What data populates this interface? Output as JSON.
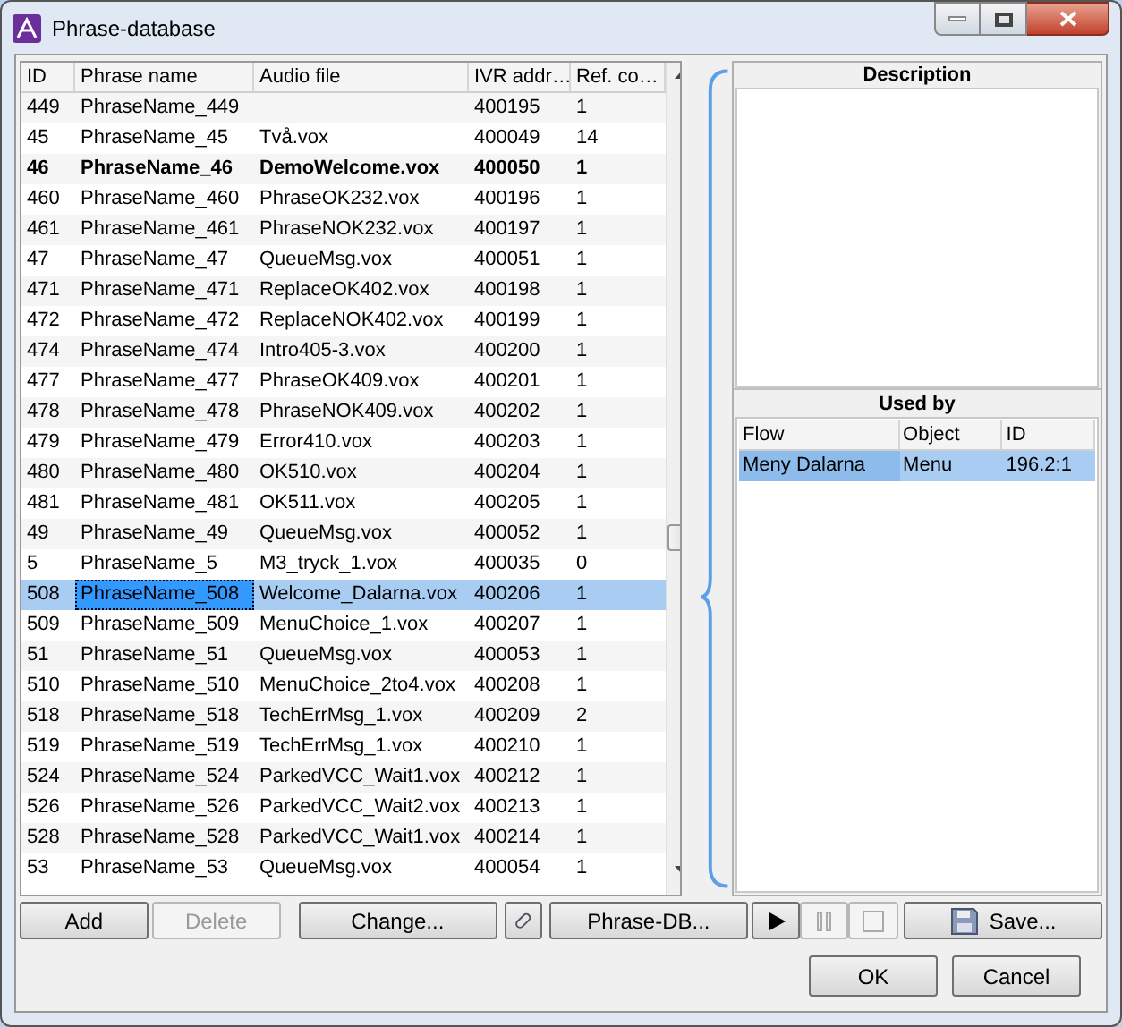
{
  "window": {
    "title": "Phrase-database"
  },
  "table": {
    "columns": [
      "ID",
      "Phrase name",
      "Audio file",
      "IVR addr…",
      "Ref. co…"
    ],
    "rows": [
      {
        "id": "449",
        "name": "PhraseName_449",
        "audio": "",
        "ivr": "400195",
        "ref": "1",
        "bold": false,
        "selected": false
      },
      {
        "id": "45",
        "name": "PhraseName_45",
        "audio": "Två.vox",
        "ivr": "400049",
        "ref": "14",
        "bold": false,
        "selected": false
      },
      {
        "id": "46",
        "name": "PhraseName_46",
        "audio": "DemoWelcome.vox",
        "ivr": "400050",
        "ref": "1",
        "bold": true,
        "selected": false
      },
      {
        "id": "460",
        "name": "PhraseName_460",
        "audio": "PhraseOK232.vox",
        "ivr": "400196",
        "ref": "1",
        "bold": false,
        "selected": false
      },
      {
        "id": "461",
        "name": "PhraseName_461",
        "audio": "PhraseNOK232.vox",
        "ivr": "400197",
        "ref": "1",
        "bold": false,
        "selected": false
      },
      {
        "id": "47",
        "name": "PhraseName_47",
        "audio": "QueueMsg.vox",
        "ivr": "400051",
        "ref": "1",
        "bold": false,
        "selected": false
      },
      {
        "id": "471",
        "name": "PhraseName_471",
        "audio": "ReplaceOK402.vox",
        "ivr": "400198",
        "ref": "1",
        "bold": false,
        "selected": false
      },
      {
        "id": "472",
        "name": "PhraseName_472",
        "audio": "ReplaceNOK402.vox",
        "ivr": "400199",
        "ref": "1",
        "bold": false,
        "selected": false
      },
      {
        "id": "474",
        "name": "PhraseName_474",
        "audio": "Intro405-3.vox",
        "ivr": "400200",
        "ref": "1",
        "bold": false,
        "selected": false
      },
      {
        "id": "477",
        "name": "PhraseName_477",
        "audio": "PhraseOK409.vox",
        "ivr": "400201",
        "ref": "1",
        "bold": false,
        "selected": false
      },
      {
        "id": "478",
        "name": "PhraseName_478",
        "audio": "PhraseNOK409.vox",
        "ivr": "400202",
        "ref": "1",
        "bold": false,
        "selected": false
      },
      {
        "id": "479",
        "name": "PhraseName_479",
        "audio": "Error410.vox",
        "ivr": "400203",
        "ref": "1",
        "bold": false,
        "selected": false
      },
      {
        "id": "480",
        "name": "PhraseName_480",
        "audio": "OK510.vox",
        "ivr": "400204",
        "ref": "1",
        "bold": false,
        "selected": false
      },
      {
        "id": "481",
        "name": "PhraseName_481",
        "audio": "OK511.vox",
        "ivr": "400205",
        "ref": "1",
        "bold": false,
        "selected": false
      },
      {
        "id": "49",
        "name": "PhraseName_49",
        "audio": "QueueMsg.vox",
        "ivr": "400052",
        "ref": "1",
        "bold": false,
        "selected": false
      },
      {
        "id": "5",
        "name": "PhraseName_5",
        "audio": "M3_tryck_1.vox",
        "ivr": "400035",
        "ref": "0",
        "bold": false,
        "selected": false
      },
      {
        "id": "508",
        "name": "PhraseName_508",
        "audio": "Welcome_Dalarna.vox",
        "ivr": "400206",
        "ref": "1",
        "bold": false,
        "selected": true
      },
      {
        "id": "509",
        "name": "PhraseName_509",
        "audio": "MenuChoice_1.vox",
        "ivr": "400207",
        "ref": "1",
        "bold": false,
        "selected": false
      },
      {
        "id": "51",
        "name": "PhraseName_51",
        "audio": "QueueMsg.vox",
        "ivr": "400053",
        "ref": "1",
        "bold": false,
        "selected": false
      },
      {
        "id": "510",
        "name": "PhraseName_510",
        "audio": "MenuChoice_2to4.vox",
        "ivr": "400208",
        "ref": "1",
        "bold": false,
        "selected": false
      },
      {
        "id": "518",
        "name": "PhraseName_518",
        "audio": "TechErrMsg_1.vox",
        "ivr": "400209",
        "ref": "2",
        "bold": false,
        "selected": false
      },
      {
        "id": "519",
        "name": "PhraseName_519",
        "audio": "TechErrMsg_1.vox",
        "ivr": "400210",
        "ref": "1",
        "bold": false,
        "selected": false
      },
      {
        "id": "524",
        "name": "PhraseName_524",
        "audio": "ParkedVCC_Wait1.vox",
        "ivr": "400212",
        "ref": "1",
        "bold": false,
        "selected": false
      },
      {
        "id": "526",
        "name": "PhraseName_526",
        "audio": "ParkedVCC_Wait2.vox",
        "ivr": "400213",
        "ref": "1",
        "bold": false,
        "selected": false
      },
      {
        "id": "528",
        "name": "PhraseName_528",
        "audio": "ParkedVCC_Wait1.vox",
        "ivr": "400214",
        "ref": "1",
        "bold": false,
        "selected": false
      },
      {
        "id": "53",
        "name": "PhraseName_53",
        "audio": "QueueMsg.vox",
        "ivr": "400054",
        "ref": "1",
        "bold": false,
        "selected": false
      }
    ]
  },
  "description": {
    "title": "Description"
  },
  "used_by": {
    "title": "Used by",
    "columns": [
      "Flow",
      "Object",
      "ID"
    ],
    "rows": [
      {
        "flow": "Meny Dalarna",
        "object": "Menu",
        "id": "196.2:1",
        "selected": true
      }
    ]
  },
  "buttons": [
    {
      "kind": "text",
      "label": "Add",
      "disabled": false
    },
    {
      "kind": "text",
      "label": "Delete",
      "disabled": true
    },
    {
      "kind": "text",
      "label": "Change...",
      "disabled": false
    },
    {
      "kind": "clip",
      "disabled": false
    },
    {
      "kind": "text",
      "label": "Phrase-DB...",
      "disabled": false
    },
    {
      "kind": "play",
      "disabled": false
    },
    {
      "kind": "pause",
      "disabled": true
    },
    {
      "kind": "stop",
      "disabled": true
    },
    {
      "kind": "save",
      "label": "Save...",
      "disabled": false
    }
  ],
  "dialog_buttons": [
    "OK",
    "Cancel"
  ]
}
